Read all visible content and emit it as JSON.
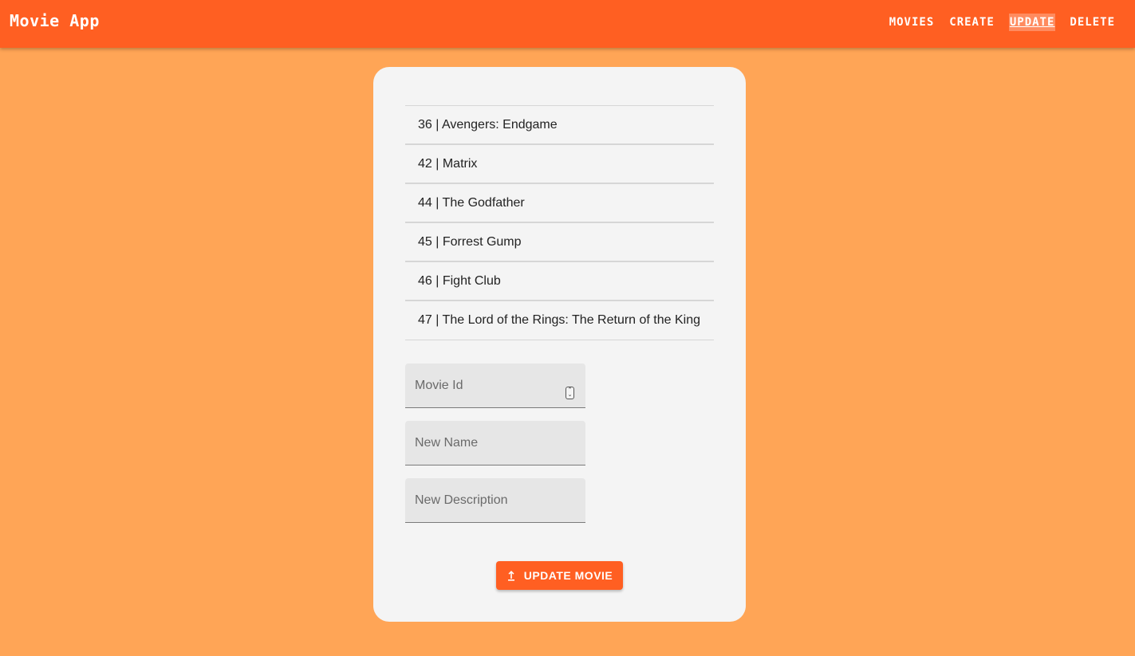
{
  "app": {
    "title": "Movie App"
  },
  "nav": {
    "items": [
      {
        "label": "MOVIES",
        "active": false
      },
      {
        "label": "CREATE",
        "active": false
      },
      {
        "label": "UPDATE",
        "active": true
      },
      {
        "label": "DELETE",
        "active": false
      }
    ]
  },
  "movies": [
    {
      "label": "36 | Avengers: Endgame"
    },
    {
      "label": "42 | Matrix"
    },
    {
      "label": "44 | The Godfather"
    },
    {
      "label": "45 | Forrest Gump"
    },
    {
      "label": "46 | Fight Club"
    },
    {
      "label": "47 | The Lord of the Rings: The Return of the King"
    }
  ],
  "form": {
    "movie_id": {
      "placeholder": "Movie Id",
      "value": ""
    },
    "new_name": {
      "placeholder": "New Name",
      "value": ""
    },
    "new_description": {
      "placeholder": "New Description",
      "value": ""
    },
    "submit_label": "UPDATE MOVIE",
    "submit_icon": "upload-icon"
  },
  "colors": {
    "background": "#ffa556",
    "appbar": "#ff5f22",
    "card": "#f4f4f4",
    "button": "#ff5f22"
  }
}
